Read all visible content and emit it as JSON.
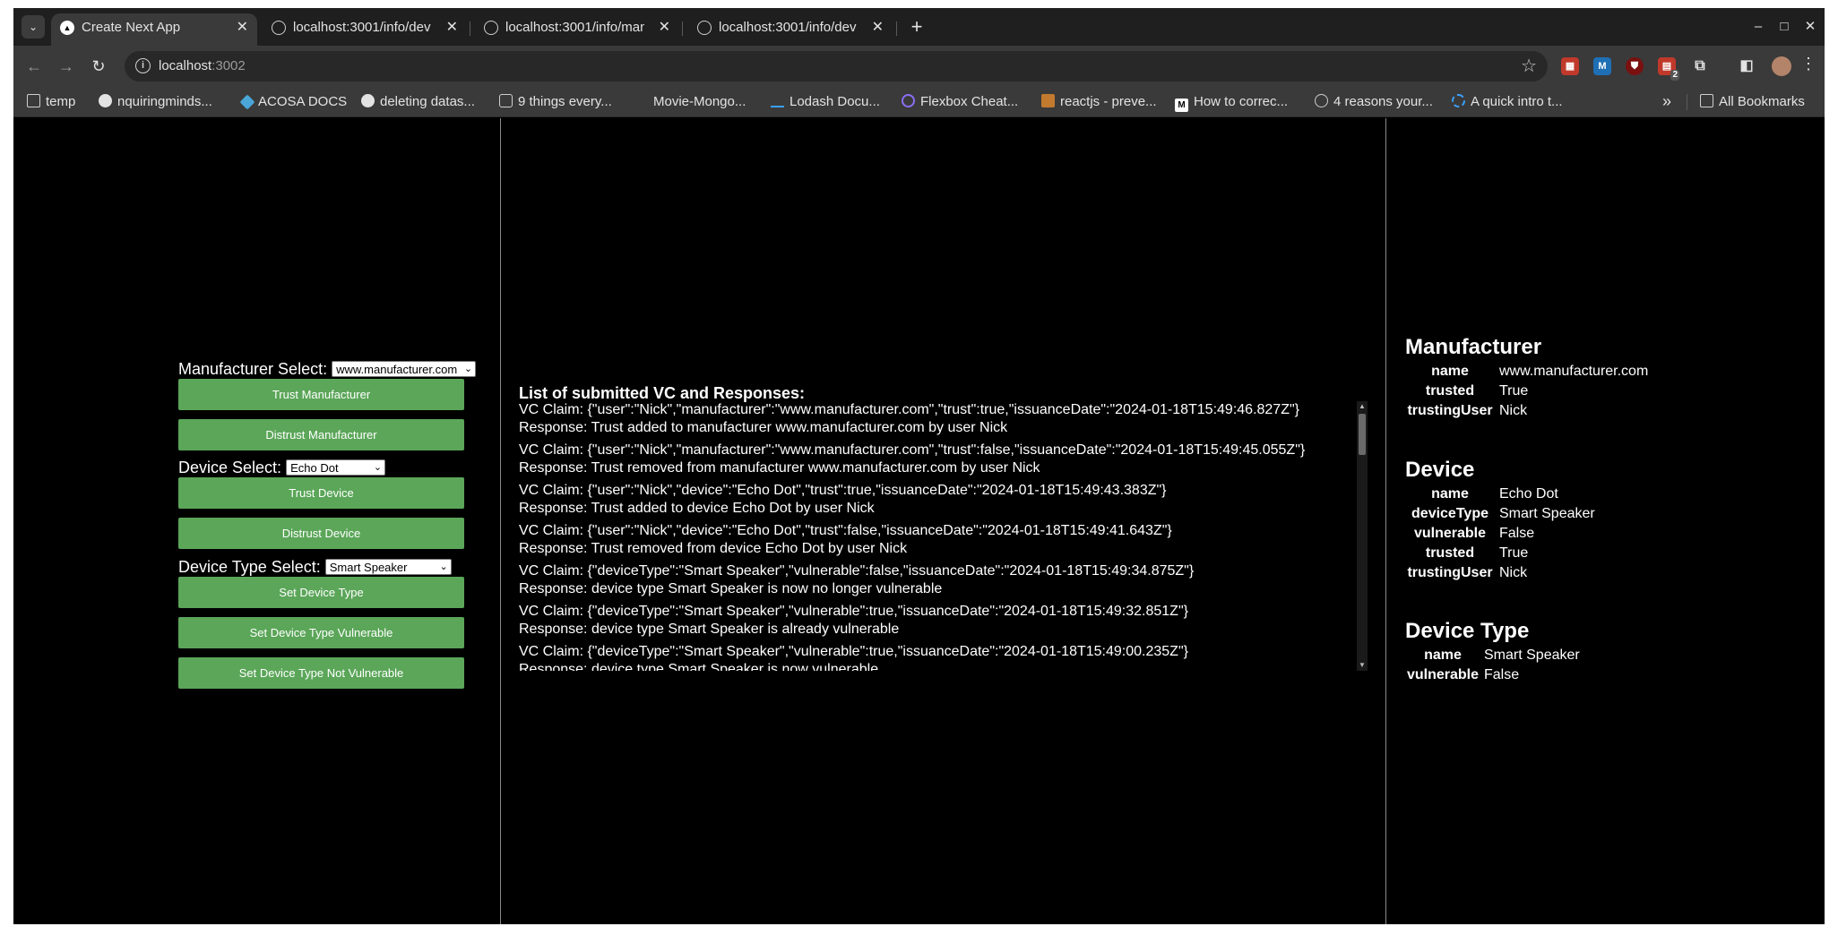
{
  "browser": {
    "tabs": [
      {
        "title": "Create Next App",
        "active": true
      },
      {
        "title": "localhost:3001/info/dev",
        "active": false
      },
      {
        "title": "localhost:3001/info/man",
        "active": false
      },
      {
        "title": "localhost:3001/info/dev",
        "active": false
      }
    ],
    "url_host": "localhost",
    "url_port": ":3002",
    "bookmarks": [
      "temp",
      "nquiringminds...",
      "ACOSA DOCS",
      "deleting datas...",
      "9 things every...",
      "Movie-Mongo...",
      "Lodash Docu...",
      "Flexbox Cheat...",
      "reactjs - preve...",
      "How to correc...",
      "4 reasons your...",
      "A quick intro t..."
    ],
    "all_bookmarks": "All Bookmarks",
    "extension_badge": "2"
  },
  "controls": {
    "manufacturer_label": "Manufacturer Select:",
    "manufacturer_value": "www.manufacturer.com",
    "trust_manufacturer": "Trust Manufacturer",
    "distrust_manufacturer": "Distrust Manufacturer",
    "device_label": "Device Select:",
    "device_value": "Echo Dot",
    "trust_device": "Trust Device",
    "distrust_device": "Distrust Device",
    "device_type_label": "Device Type Select:",
    "device_type_value": "Smart Speaker",
    "set_device_type": "Set Device Type",
    "set_vulnerable": "Set Device Type Vulnerable",
    "set_not_vulnerable": "Set Device Type Not Vulnerable"
  },
  "log": {
    "title": "List of submitted VC and Responses:",
    "items": [
      {
        "claim": "VC Claim: {\"user\":\"Nick\",\"manufacturer\":\"www.manufacturer.com\",\"trust\":true,\"issuanceDate\":\"2024-01-18T15:49:46.827Z\"}",
        "response": "Response: Trust added to manufacturer www.manufacturer.com by user Nick"
      },
      {
        "claim": "VC Claim: {\"user\":\"Nick\",\"manufacturer\":\"www.manufacturer.com\",\"trust\":false,\"issuanceDate\":\"2024-01-18T15:49:45.055Z\"}",
        "response": "Response: Trust removed from manufacturer www.manufacturer.com by user Nick"
      },
      {
        "claim": "VC Claim: {\"user\":\"Nick\",\"device\":\"Echo Dot\",\"trust\":true,\"issuanceDate\":\"2024-01-18T15:49:43.383Z\"}",
        "response": "Response: Trust added to device Echo Dot by user Nick"
      },
      {
        "claim": "VC Claim: {\"user\":\"Nick\",\"device\":\"Echo Dot\",\"trust\":false,\"issuanceDate\":\"2024-01-18T15:49:41.643Z\"}",
        "response": "Response: Trust removed from device Echo Dot by user Nick"
      },
      {
        "claim": "VC Claim: {\"deviceType\":\"Smart Speaker\",\"vulnerable\":false,\"issuanceDate\":\"2024-01-18T15:49:34.875Z\"}",
        "response": "Response: device type Smart Speaker is now no longer vulnerable"
      },
      {
        "claim": "VC Claim: {\"deviceType\":\"Smart Speaker\",\"vulnerable\":true,\"issuanceDate\":\"2024-01-18T15:49:32.851Z\"}",
        "response": "Response: device type Smart Speaker is already vulnerable"
      },
      {
        "claim": "VC Claim: {\"deviceType\":\"Smart Speaker\",\"vulnerable\":true,\"issuanceDate\":\"2024-01-18T15:49:00.235Z\"}",
        "response": "Response: device type Smart Speaker is now vulnerable"
      }
    ]
  },
  "info": {
    "manufacturer": {
      "heading": "Manufacturer",
      "rows": [
        {
          "key": "name",
          "value": "www.manufacturer.com"
        },
        {
          "key": "trusted",
          "value": "True"
        },
        {
          "key": "trustingUser",
          "value": "Nick"
        }
      ]
    },
    "device": {
      "heading": "Device",
      "rows": [
        {
          "key": "name",
          "value": "Echo Dot"
        },
        {
          "key": "deviceType",
          "value": "Smart Speaker"
        },
        {
          "key": "vulnerable",
          "value": "False"
        },
        {
          "key": "trusted",
          "value": "True"
        },
        {
          "key": "trustingUser",
          "value": "Nick"
        }
      ]
    },
    "device_type": {
      "heading": "Device Type",
      "rows": [
        {
          "key": "name",
          "value": "Smart Speaker"
        },
        {
          "key": "vulnerable",
          "value": "False"
        }
      ]
    }
  },
  "colors": {
    "button_green": "#5ba659",
    "page_background": "#000000",
    "chrome_dark": "#3a3a3a"
  }
}
